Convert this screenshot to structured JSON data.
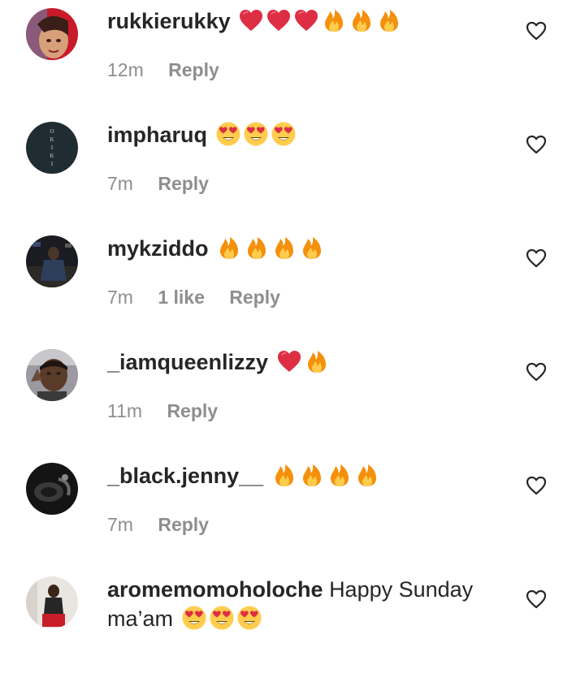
{
  "comments": [
    {
      "username": "rukkierukky",
      "text": "",
      "emojis": [
        "heart",
        "heart",
        "heart",
        "fire",
        "fire",
        "fire"
      ],
      "time": "12m",
      "likes": "",
      "reply": "Reply"
    },
    {
      "username": "impharuq",
      "text": "",
      "emojis": [
        "heart-eyes",
        "heart-eyes",
        "heart-eyes"
      ],
      "time": "7m",
      "likes": "",
      "reply": "Reply",
      "avatar_text": "OKIKI"
    },
    {
      "username": "mykziddo",
      "text": "",
      "emojis": [
        "fire",
        "fire",
        "fire",
        "fire"
      ],
      "time": "7m",
      "likes": "1 like",
      "reply": "Reply"
    },
    {
      "username": "_iamqueenlizzy",
      "text": "",
      "emojis": [
        "heart",
        "fire"
      ],
      "time": "11m",
      "likes": "",
      "reply": "Reply"
    },
    {
      "username": "_black.jenny__",
      "text": "",
      "emojis": [
        "fire",
        "fire",
        "fire",
        "fire"
      ],
      "time": "7m",
      "likes": "",
      "reply": "Reply"
    },
    {
      "username": "aromemomoholoche",
      "text": "Happy Sunday ma’am",
      "emojis": [
        "heart-eyes",
        "heart-eyes",
        "heart-eyes"
      ],
      "time": "",
      "likes": "",
      "reply": ""
    }
  ],
  "colors": {
    "username": "#262626",
    "meta": "#8e8e8e",
    "like_icon": "#262626"
  },
  "icons": {
    "like_button": "heart-outline-icon"
  }
}
